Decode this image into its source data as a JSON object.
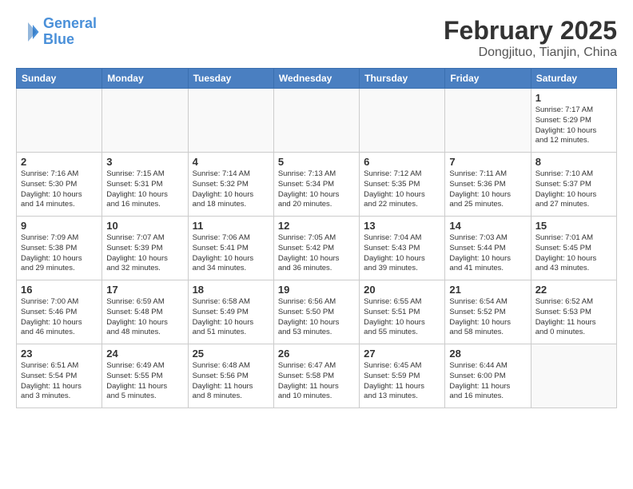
{
  "logo": {
    "line1": "General",
    "line2": "Blue"
  },
  "title": "February 2025",
  "location": "Dongjituo, Tianjin, China",
  "days_of_week": [
    "Sunday",
    "Monday",
    "Tuesday",
    "Wednesday",
    "Thursday",
    "Friday",
    "Saturday"
  ],
  "weeks": [
    [
      {
        "day": "",
        "info": ""
      },
      {
        "day": "",
        "info": ""
      },
      {
        "day": "",
        "info": ""
      },
      {
        "day": "",
        "info": ""
      },
      {
        "day": "",
        "info": ""
      },
      {
        "day": "",
        "info": ""
      },
      {
        "day": "1",
        "info": "Sunrise: 7:17 AM\nSunset: 5:29 PM\nDaylight: 10 hours\nand 12 minutes."
      }
    ],
    [
      {
        "day": "2",
        "info": "Sunrise: 7:16 AM\nSunset: 5:30 PM\nDaylight: 10 hours\nand 14 minutes."
      },
      {
        "day": "3",
        "info": "Sunrise: 7:15 AM\nSunset: 5:31 PM\nDaylight: 10 hours\nand 16 minutes."
      },
      {
        "day": "4",
        "info": "Sunrise: 7:14 AM\nSunset: 5:32 PM\nDaylight: 10 hours\nand 18 minutes."
      },
      {
        "day": "5",
        "info": "Sunrise: 7:13 AM\nSunset: 5:34 PM\nDaylight: 10 hours\nand 20 minutes."
      },
      {
        "day": "6",
        "info": "Sunrise: 7:12 AM\nSunset: 5:35 PM\nDaylight: 10 hours\nand 22 minutes."
      },
      {
        "day": "7",
        "info": "Sunrise: 7:11 AM\nSunset: 5:36 PM\nDaylight: 10 hours\nand 25 minutes."
      },
      {
        "day": "8",
        "info": "Sunrise: 7:10 AM\nSunset: 5:37 PM\nDaylight: 10 hours\nand 27 minutes."
      }
    ],
    [
      {
        "day": "9",
        "info": "Sunrise: 7:09 AM\nSunset: 5:38 PM\nDaylight: 10 hours\nand 29 minutes."
      },
      {
        "day": "10",
        "info": "Sunrise: 7:07 AM\nSunset: 5:39 PM\nDaylight: 10 hours\nand 32 minutes."
      },
      {
        "day": "11",
        "info": "Sunrise: 7:06 AM\nSunset: 5:41 PM\nDaylight: 10 hours\nand 34 minutes."
      },
      {
        "day": "12",
        "info": "Sunrise: 7:05 AM\nSunset: 5:42 PM\nDaylight: 10 hours\nand 36 minutes."
      },
      {
        "day": "13",
        "info": "Sunrise: 7:04 AM\nSunset: 5:43 PM\nDaylight: 10 hours\nand 39 minutes."
      },
      {
        "day": "14",
        "info": "Sunrise: 7:03 AM\nSunset: 5:44 PM\nDaylight: 10 hours\nand 41 minutes."
      },
      {
        "day": "15",
        "info": "Sunrise: 7:01 AM\nSunset: 5:45 PM\nDaylight: 10 hours\nand 43 minutes."
      }
    ],
    [
      {
        "day": "16",
        "info": "Sunrise: 7:00 AM\nSunset: 5:46 PM\nDaylight: 10 hours\nand 46 minutes."
      },
      {
        "day": "17",
        "info": "Sunrise: 6:59 AM\nSunset: 5:48 PM\nDaylight: 10 hours\nand 48 minutes."
      },
      {
        "day": "18",
        "info": "Sunrise: 6:58 AM\nSunset: 5:49 PM\nDaylight: 10 hours\nand 51 minutes."
      },
      {
        "day": "19",
        "info": "Sunrise: 6:56 AM\nSunset: 5:50 PM\nDaylight: 10 hours\nand 53 minutes."
      },
      {
        "day": "20",
        "info": "Sunrise: 6:55 AM\nSunset: 5:51 PM\nDaylight: 10 hours\nand 55 minutes."
      },
      {
        "day": "21",
        "info": "Sunrise: 6:54 AM\nSunset: 5:52 PM\nDaylight: 10 hours\nand 58 minutes."
      },
      {
        "day": "22",
        "info": "Sunrise: 6:52 AM\nSunset: 5:53 PM\nDaylight: 11 hours\nand 0 minutes."
      }
    ],
    [
      {
        "day": "23",
        "info": "Sunrise: 6:51 AM\nSunset: 5:54 PM\nDaylight: 11 hours\nand 3 minutes."
      },
      {
        "day": "24",
        "info": "Sunrise: 6:49 AM\nSunset: 5:55 PM\nDaylight: 11 hours\nand 5 minutes."
      },
      {
        "day": "25",
        "info": "Sunrise: 6:48 AM\nSunset: 5:56 PM\nDaylight: 11 hours\nand 8 minutes."
      },
      {
        "day": "26",
        "info": "Sunrise: 6:47 AM\nSunset: 5:58 PM\nDaylight: 11 hours\nand 10 minutes."
      },
      {
        "day": "27",
        "info": "Sunrise: 6:45 AM\nSunset: 5:59 PM\nDaylight: 11 hours\nand 13 minutes."
      },
      {
        "day": "28",
        "info": "Sunrise: 6:44 AM\nSunset: 6:00 PM\nDaylight: 11 hours\nand 16 minutes."
      },
      {
        "day": "",
        "info": ""
      }
    ]
  ]
}
